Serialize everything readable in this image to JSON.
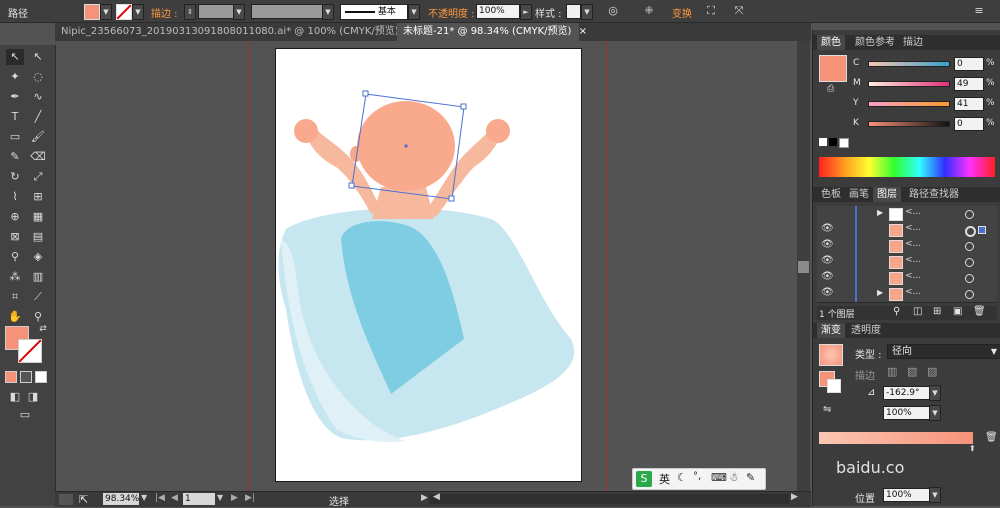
{
  "control_bar": {
    "object_type": "路径",
    "stroke_label": "描边 :",
    "stroke_style_label": "基本",
    "opacity_label": "不透明度 :",
    "opacity_value": "100%",
    "style_label": "样式 :",
    "transform_label": "变换",
    "fill_color": "#f7927a"
  },
  "document_tabs": [
    {
      "label": "Nipic_23566073_20190313091808011080.ai* @ 100% (CMYK/预览)",
      "close": "×"
    },
    {
      "label": "未标题-21* @ 98.34% (CMYK/预览)",
      "close": "×"
    }
  ],
  "status_bar": {
    "zoom": "98.34%",
    "page": "1",
    "tool_name": "选择"
  },
  "color_panel": {
    "tabs": [
      "颜色",
      "颜色参考",
      "描边"
    ],
    "c_label": "C",
    "c_value": "0",
    "m_label": "M",
    "m_value": "49",
    "y_label": "Y",
    "y_value": "41",
    "k_label": "K",
    "k_value": "0",
    "unit": "%",
    "swatch_color": "#f7927a"
  },
  "layers_panel": {
    "tabs": [
      "色板",
      "画笔",
      "图层",
      "路径查找器"
    ],
    "rows": [
      "<...",
      "<...",
      "<...",
      "<...",
      "<...",
      "<..."
    ],
    "footer_label": "1 个图层"
  },
  "gradient_panel": {
    "tabs": [
      "渐变",
      "透明度"
    ],
    "type_label": "类型 :",
    "type_value": "径向",
    "stroke_label": "描边",
    "angle_value": "-162.9°",
    "aspect_value": "100%",
    "position_label": "位置",
    "position_value": "100%"
  },
  "ime_bar": {
    "lang": "英"
  },
  "watermark": {
    "text": "baidu.co"
  }
}
